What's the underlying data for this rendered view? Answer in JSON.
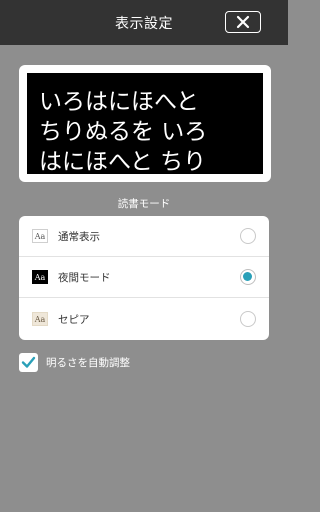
{
  "header": {
    "title": "表示設定",
    "close_icon": "close-icon"
  },
  "preview": {
    "lines": "いろはにほへと\nちりぬるを いろ\nはにほへと ちり"
  },
  "reading_mode": {
    "title": "読書モード",
    "items": [
      {
        "icon_text": "Aa",
        "label": "通常表示",
        "selected": false
      },
      {
        "icon_text": "Aa",
        "label": "夜間モード",
        "selected": true
      },
      {
        "icon_text": "Aa",
        "label": "セピア",
        "selected": false
      }
    ]
  },
  "auto_brightness": {
    "label": "明るさを自動調整",
    "checked": true
  },
  "colors": {
    "header_bg": "#333333",
    "page_bg": "#8e8e8e",
    "accent": "#2aa0b8"
  }
}
